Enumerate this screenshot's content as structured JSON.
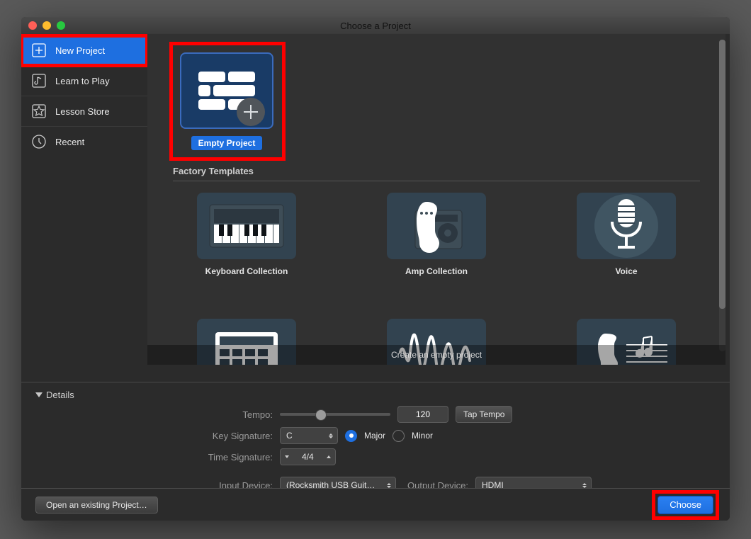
{
  "window": {
    "title": "Choose a Project"
  },
  "sidebar": {
    "items": [
      {
        "label": "New Project",
        "icon": "new-project-icon",
        "active": true,
        "divider": true
      },
      {
        "label": "Learn to Play",
        "icon": "learn-icon",
        "active": false,
        "divider": true
      },
      {
        "label": "Lesson Store",
        "icon": "store-icon",
        "active": false,
        "divider": true
      },
      {
        "label": "Recent",
        "icon": "recent-icon",
        "active": false,
        "divider": false
      }
    ]
  },
  "main": {
    "hero": {
      "label": "Empty Project"
    },
    "section_header": "Factory Templates",
    "templates": [
      {
        "label": "Keyboard Collection",
        "icon": "keyboard-icon"
      },
      {
        "label": "Amp Collection",
        "icon": "amp-icon"
      },
      {
        "label": "Voice",
        "icon": "mic-icon"
      },
      {
        "label": "",
        "icon": "drummachine-icon"
      },
      {
        "label": "",
        "icon": "waveform-icon"
      },
      {
        "label": "",
        "icon": "guitar-icon"
      }
    ],
    "hint": "Create an empty project"
  },
  "details": {
    "toggle_label": "Details",
    "tempo_label": "Tempo:",
    "tempo_value": "120",
    "tap_tempo": "Tap Tempo",
    "key_label": "Key Signature:",
    "key_value": "C",
    "mode_major": "Major",
    "mode_minor": "Minor",
    "time_label": "Time Signature:",
    "time_value": "4/4",
    "input_label": "Input Device:",
    "input_value": "(Rocksmith USB Guit…",
    "output_label": "Output Device:",
    "output_value": "HDMI"
  },
  "footer": {
    "open_existing": "Open an existing Project…",
    "choose": "Choose"
  }
}
